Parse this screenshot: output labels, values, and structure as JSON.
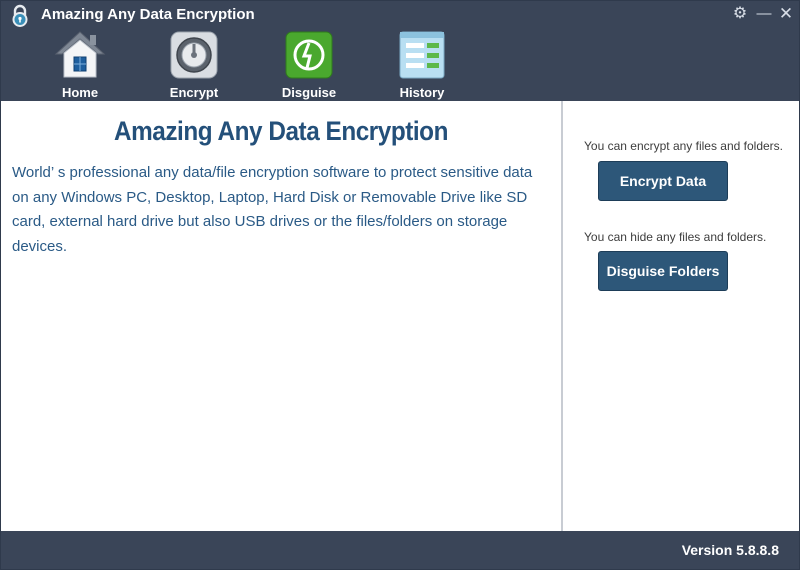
{
  "window": {
    "title": "Amazing Any Data Encryption",
    "controls": [
      "settings-icon",
      "minimize-icon",
      "close-icon"
    ]
  },
  "nav": {
    "items": [
      {
        "label": "Home",
        "icon": "home-icon"
      },
      {
        "label": "Encrypt",
        "icon": "vault-icon"
      },
      {
        "label": "Disguise",
        "icon": "shield-icon"
      },
      {
        "label": "History",
        "icon": "history-list-icon"
      }
    ]
  },
  "main": {
    "headline": "Amazing Any Data Encryption",
    "description": "World’ s professional any data/file encryption software to protect sensitive data on any Windows PC, Desktop, Laptop, Hard Disk or Removable Drive like SD card, external hard drive but also USB drives or the files/folders on storage devices."
  },
  "side": {
    "encrypt_hint": "You can encrypt any files and folders.",
    "encrypt_button": "Encrypt Data",
    "disguise_hint": "You can hide any files and folders.",
    "disguise_button": "Disguise Folders"
  },
  "footer": {
    "version": "Version 5.8.8.8"
  },
  "colors": {
    "titlebar": "#3a4558",
    "headline": "#24507a",
    "description": "#2a5a86",
    "button": "#2d5779",
    "disguise_icon": "#4aa82e"
  }
}
